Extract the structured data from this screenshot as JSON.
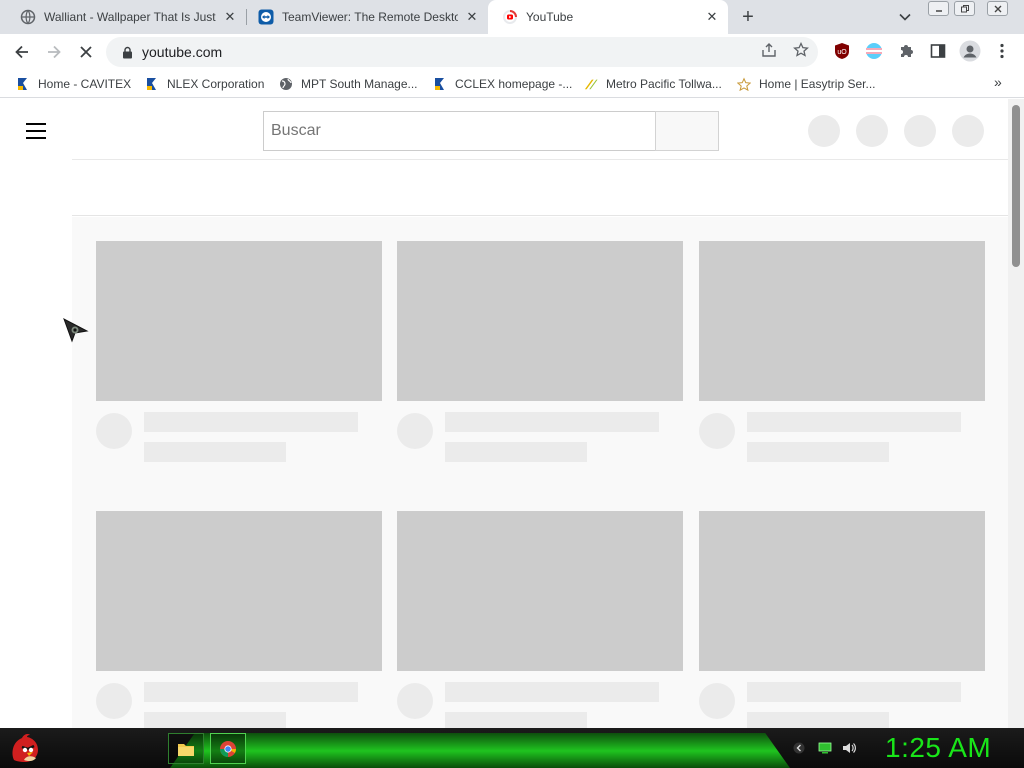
{
  "tabs": [
    {
      "title": "Walliant - Wallpaper That Is Just For You",
      "icon": "globe-icon"
    },
    {
      "title": "TeamViewer: The Remote Desktop Software",
      "icon": "teamviewer-icon"
    },
    {
      "title": "YouTube",
      "icon": "youtube-icon",
      "active": true
    }
  ],
  "toolbar": {
    "url": "youtube.com",
    "extensions": [
      "ublock-icon",
      "trans-flag-extension-icon",
      "puzzle-extensions-icon",
      "side-panel-icon",
      "profile-icon",
      "kebab-menu-icon"
    ]
  },
  "bookmarks": [
    {
      "label": "Home - CAVITEX",
      "icon": "bookmark-flag-icon"
    },
    {
      "label": "NLEX Corporation",
      "icon": "bookmark-flag-icon"
    },
    {
      "label": "MPT South Manage...",
      "icon": "globe-icon"
    },
    {
      "label": "CCLEX homepage -...",
      "icon": "bookmark-flag-icon"
    },
    {
      "label": "Metro Pacific Tollwa...",
      "icon": "metro-pacific-icon"
    },
    {
      "label": "Home | Easytrip Ser...",
      "icon": "easytrip-icon"
    }
  ],
  "youtube": {
    "search_placeholder": "Buscar"
  },
  "taskbar": {
    "clock": "1:25 AM",
    "apps": [
      "file-explorer-icon",
      "chrome-icon"
    ]
  },
  "colors": {
    "clock": "#19e619",
    "placeholder_thumb": "#cccccc",
    "placeholder_line": "#ebebeb",
    "accent_youtube": "#ff0000"
  }
}
